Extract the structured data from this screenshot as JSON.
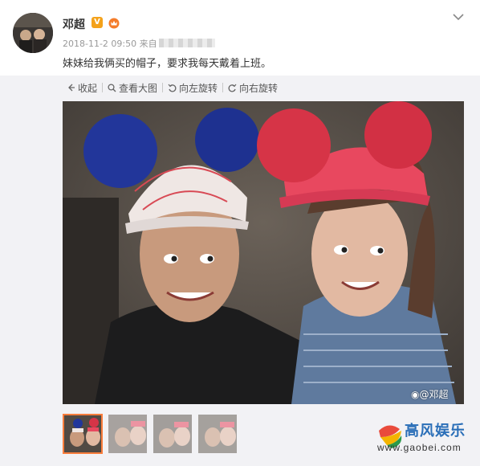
{
  "post": {
    "author": "邓超",
    "verified_badge": "V",
    "timestamp": "2018-11-2 09:50",
    "source_prefix": "来自",
    "text": "妹妹给我俩买的帽子，要求我每天戴着上班。"
  },
  "toolbar": {
    "collapse_label": "收起",
    "view_large_label": "查看大图",
    "rotate_left_label": "向左旋转",
    "rotate_right_label": "向右旋转"
  },
  "photo": {
    "watermark": "@邓超"
  },
  "thumbnails": {
    "count": 4,
    "selected_index": 0
  },
  "site_logo": {
    "text": "高风娱乐",
    "url": "www.gaobei.com"
  },
  "icons": {
    "collapse": "arrow-left-icon",
    "view_large": "magnifier-icon",
    "rotate_left": "rotate-left-icon",
    "rotate_right": "rotate-right-icon",
    "more": "chevron-down-icon",
    "weibo": "weibo-icon"
  },
  "colors": {
    "accent_orange": "#fa7d3c",
    "badge_gold": "#f4a21b",
    "logo_blue": "#2b6fb8",
    "panel_bg": "#f2f2f5"
  }
}
